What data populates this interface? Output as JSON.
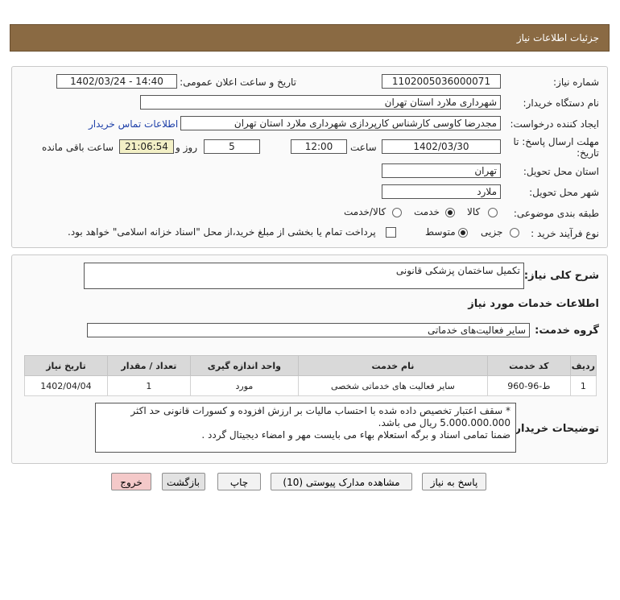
{
  "header": {
    "title": "جزئیات اطلاعات نیاز"
  },
  "fields": {
    "need_number_label": "شماره نیاز:",
    "need_number": "1102005036000071",
    "announce_label": "تاریخ و ساعت اعلان عمومی:",
    "announce_value": "1402/03/24 - 14:40",
    "buyer_label": "نام دستگاه خریدار:",
    "buyer_value": "شهرداری ملارد استان تهران",
    "creator_label": "ایجاد کننده درخواست:",
    "creator_value": "مجدرضا کاوسی کارشناس کارپردازی شهرداری ملارد استان تهران",
    "contact_link": "اطلاعات تماس خریدار",
    "deadline_label_1": "مهلت ارسال پاسخ: تا",
    "deadline_label_2": "تاریخ:",
    "deadline_date": "1402/03/30",
    "time_label": "ساعت",
    "deadline_time": "12:00",
    "days_value": "5",
    "days_label": "روز و",
    "remaining_time": "21:06:54",
    "remaining_label": "ساعت باقی مانده",
    "province_label": "استان محل تحویل:",
    "province_value": "تهران",
    "city_label": "شهر محل تحویل:",
    "city_value": "ملارد",
    "category_label": "طبقه بندی موضوعی:",
    "category_options": [
      "کالا",
      "خدمت",
      "کالا/خدمت"
    ],
    "process_label": "نوع فرآیند خرید :",
    "process_options": [
      "جزیی",
      "متوسط"
    ],
    "payment_note": "پرداخت تمام یا بخشی از مبلغ خرید،از محل \"اسناد خزانه اسلامی\" خواهد بود."
  },
  "summary": {
    "label": "شرح کلی نیاز:",
    "value": "تکمیل ساختمان پزشکی قانونی",
    "services_title": "اطلاعات خدمات مورد نیاز",
    "group_label": "گروه خدمت:",
    "group_value": "سایر فعالیت‌های خدماتی"
  },
  "table": {
    "headers": [
      "ردیف",
      "کد خدمت",
      "نام خدمت",
      "واحد اندازه گیری",
      "تعداد / مقدار",
      "تاریخ نیاز"
    ],
    "rows": [
      [
        "1",
        "ط-96-960",
        "سایر فعالیت های خدماتی شخصی",
        "مورد",
        "1",
        "1402/04/04"
      ]
    ]
  },
  "description": {
    "label": "توضیحات خریدار:",
    "line1": "* سقف اعتبار تخصیص داده شده با احتساب مالیات بر ارزش افزوده و کسورات قانونی حد اکثر",
    "line2": "5.000.000.000 ریال می باشد.",
    "line3": "ضمنا تمامی اسناد و برگه استعلام بهاء می بایست مهر و امضاء دیجیتال گردد ."
  },
  "buttons": {
    "reply": "پاسخ به نیاز",
    "attachments": "مشاهده مدارک پیوستی (10)",
    "print": "چاپ",
    "back": "بازگشت",
    "exit": "خروج"
  }
}
